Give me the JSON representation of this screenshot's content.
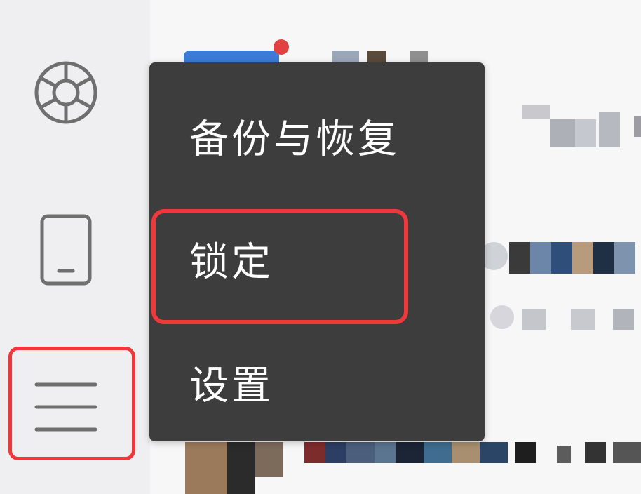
{
  "sidebar": {
    "icons": [
      "moments-icon",
      "phone-icon",
      "menu-icon"
    ]
  },
  "menu": {
    "items": [
      {
        "label": "备份与恢复"
      },
      {
        "label": "锁定"
      },
      {
        "label": "设置"
      }
    ]
  },
  "colors": {
    "highlight": "#f0383a",
    "menu_bg": "#3d3d3d",
    "menu_text": "#ffffff",
    "sidebar_bg": "#efeff1",
    "icon": "#6f6f6f"
  }
}
